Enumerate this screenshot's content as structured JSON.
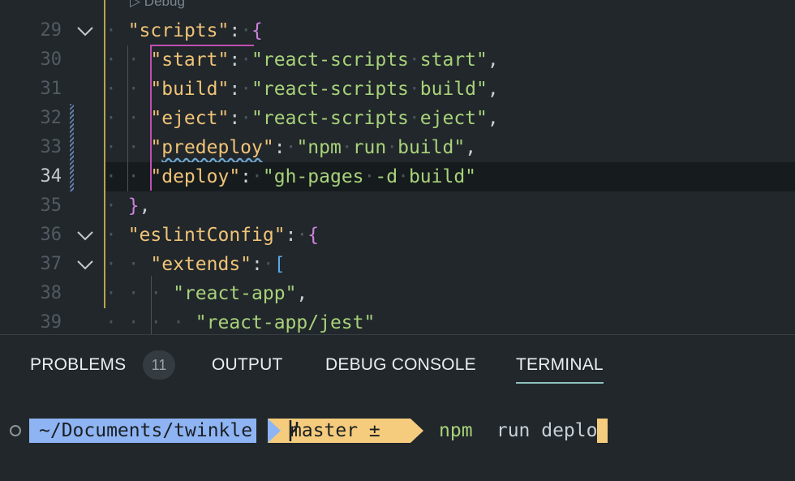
{
  "editor": {
    "codelens": "▷ Debug",
    "lines": [
      {
        "num": "29",
        "tokens": [
          [
            "ws",
            "· "
          ],
          [
            "k",
            "\"scripts\""
          ],
          [
            "p",
            ":"
          ],
          [
            "ws",
            "·"
          ],
          [
            "bb",
            "{"
          ]
        ]
      },
      {
        "num": "30",
        "tokens": [
          [
            "ws",
            "· · "
          ],
          [
            "k",
            "\"start\""
          ],
          [
            "p",
            ":"
          ],
          [
            "ws",
            "·"
          ],
          [
            "s",
            "\"react-scripts"
          ],
          [
            "ws",
            "·"
          ],
          [
            "s",
            "start\""
          ],
          [
            "p",
            ","
          ]
        ]
      },
      {
        "num": "31",
        "tokens": [
          [
            "ws",
            "· · "
          ],
          [
            "k",
            "\"build\""
          ],
          [
            "p",
            ":"
          ],
          [
            "ws",
            "·"
          ],
          [
            "s",
            "\"react-scripts"
          ],
          [
            "ws",
            "·"
          ],
          [
            "s",
            "build\""
          ],
          [
            "p",
            ","
          ]
        ]
      },
      {
        "num": "32",
        "tokens": [
          [
            "ws",
            "· · "
          ],
          [
            "k",
            "\"eject\""
          ],
          [
            "p",
            ":"
          ],
          [
            "ws",
            "·"
          ],
          [
            "s",
            "\"react-scripts"
          ],
          [
            "ws",
            "·"
          ],
          [
            "s",
            "eject\""
          ],
          [
            "p",
            ","
          ]
        ]
      },
      {
        "num": "33",
        "tokens": [
          [
            "ws",
            "· · "
          ],
          [
            "k",
            "\""
          ],
          [
            "kw",
            "predeploy"
          ],
          [
            "k",
            "\""
          ],
          [
            "p",
            ":"
          ],
          [
            "ws",
            "·"
          ],
          [
            "s",
            "\"npm"
          ],
          [
            "ws",
            "·"
          ],
          [
            "s",
            "run"
          ],
          [
            "ws",
            "·"
          ],
          [
            "s",
            "build\""
          ],
          [
            "p",
            ","
          ]
        ]
      },
      {
        "num": "34",
        "tokens": [
          [
            "ws",
            "· · "
          ],
          [
            "k",
            "\"deploy\""
          ],
          [
            "p",
            ":"
          ],
          [
            "ws",
            "·"
          ],
          [
            "s",
            "\"gh-pages"
          ],
          [
            "ws",
            "·"
          ],
          [
            "s",
            "-d"
          ],
          [
            "ws",
            "·"
          ],
          [
            "s",
            "build\""
          ]
        ]
      },
      {
        "num": "35",
        "tokens": [
          [
            "ws",
            "· "
          ],
          [
            "bb",
            "}"
          ],
          [
            "p",
            ","
          ]
        ]
      },
      {
        "num": "36",
        "tokens": [
          [
            "ws",
            "· "
          ],
          [
            "k",
            "\"eslintConfig\""
          ],
          [
            "p",
            ":"
          ],
          [
            "ws",
            "·"
          ],
          [
            "bb",
            "{"
          ]
        ]
      },
      {
        "num": "37",
        "tokens": [
          [
            "ws",
            "· · "
          ],
          [
            "k",
            "\"extends\""
          ],
          [
            "p",
            ":"
          ],
          [
            "ws",
            "·"
          ],
          [
            "bbl",
            "["
          ]
        ]
      },
      {
        "num": "38",
        "tokens": [
          [
            "ws",
            "· · · "
          ],
          [
            "s",
            "\"react-app\""
          ],
          [
            "p",
            ","
          ]
        ]
      },
      {
        "num": "39",
        "tokens": [
          [
            "ws",
            "· · · · "
          ],
          [
            "s",
            "\"react-app/jest\""
          ]
        ]
      }
    ]
  },
  "panel": {
    "tabs": {
      "problems": "PROBLEMS",
      "problems_count": "11",
      "output": "OUTPUT",
      "debug_console": "DEBUG CONSOLE",
      "terminal": "TERMINAL"
    },
    "active_tab": "TERMINAL",
    "terminal": {
      "path": "~/Documents/twinkle",
      "branch": "master ±",
      "command": "npm",
      "args": " run deploy"
    }
  },
  "colors": {
    "background": "#21272b",
    "path_segment": "#8fb4f4",
    "git_segment": "#f5cc7d",
    "string": "#a8d27a",
    "key": "#f0c377"
  }
}
